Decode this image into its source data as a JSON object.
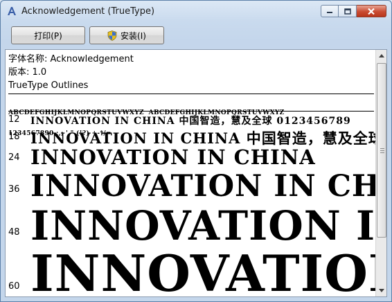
{
  "window": {
    "title": "Acknowledgement (TrueType)"
  },
  "toolbar": {
    "print_label": "打印(P)",
    "install_label": "安装(I)"
  },
  "font_info": {
    "name_line": "字体名称: Acknowledgement",
    "version_line": "版本: 1.0",
    "type_line": "TrueType Outlines"
  },
  "charset": {
    "line1": "ABCDEFGHIJKLMNOPQRSTUVWXYZ  ABCDEFGHIJKLMNOPQRSTUVWXYZ",
    "line2": "1234567890.:,; ' \" (!?) +-*/="
  },
  "samples": [
    {
      "size": "12",
      "text": "INNOVATION IN CHINA 中国智造，慧及全球 0123456789"
    },
    {
      "size": "18",
      "text": "INNOVATION IN CHINA 中国智造，慧及全球"
    },
    {
      "size": "24",
      "text": "INNOVATION IN CHINA"
    },
    {
      "size": "36",
      "text": "INNOVATION IN CHINA"
    },
    {
      "size": "48",
      "text": "INNOVATION IN CHINA"
    },
    {
      "size": "60",
      "text": "INNOVATION IN CHINA"
    }
  ]
}
